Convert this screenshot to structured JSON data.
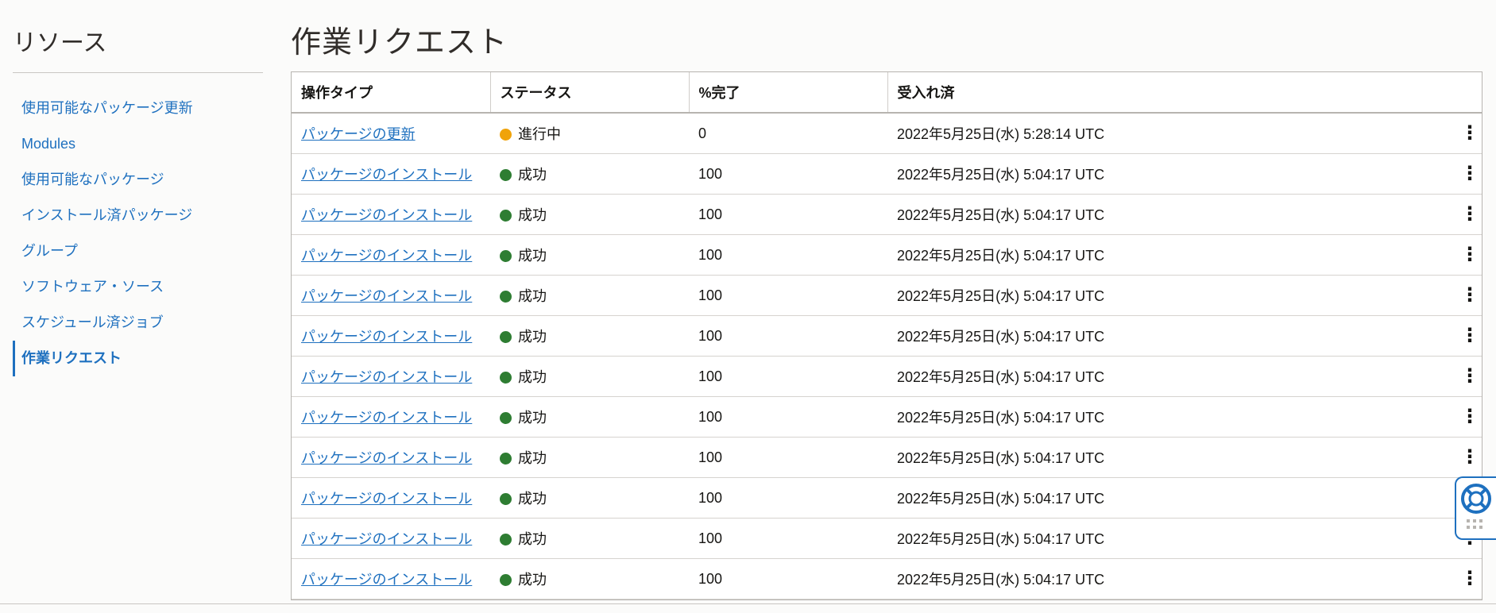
{
  "sidebar": {
    "title": "リソース",
    "items": [
      {
        "label": "使用可能なパッケージ更新"
      },
      {
        "label": "Modules"
      },
      {
        "label": "使用可能なパッケージ"
      },
      {
        "label": "インストール済パッケージ"
      },
      {
        "label": "グループ"
      },
      {
        "label": "ソフトウェア・ソース"
      },
      {
        "label": "スケジュール済ジョブ"
      },
      {
        "label": "作業リクエスト"
      }
    ],
    "active_index": 7
  },
  "page": {
    "title": "作業リクエスト"
  },
  "table": {
    "headers": [
      "操作タイプ",
      "ステータス",
      "%完了",
      "受入れ済"
    ],
    "rows": [
      {
        "type": "パッケージの更新",
        "status": "進行中",
        "percent": "0",
        "accepted": "2022年5月25日(水) 5:28:14 UTC"
      },
      {
        "type": "パッケージのインストール",
        "status": "成功",
        "percent": "100",
        "accepted": "2022年5月25日(水) 5:04:17 UTC"
      },
      {
        "type": "パッケージのインストール",
        "status": "成功",
        "percent": "100",
        "accepted": "2022年5月25日(水) 5:04:17 UTC"
      },
      {
        "type": "パッケージのインストール",
        "status": "成功",
        "percent": "100",
        "accepted": "2022年5月25日(水) 5:04:17 UTC"
      },
      {
        "type": "パッケージのインストール",
        "status": "成功",
        "percent": "100",
        "accepted": "2022年5月25日(水) 5:04:17 UTC"
      },
      {
        "type": "パッケージのインストール",
        "status": "成功",
        "percent": "100",
        "accepted": "2022年5月25日(水) 5:04:17 UTC"
      },
      {
        "type": "パッケージのインストール",
        "status": "成功",
        "percent": "100",
        "accepted": "2022年5月25日(水) 5:04:17 UTC"
      },
      {
        "type": "パッケージのインストール",
        "status": "成功",
        "percent": "100",
        "accepted": "2022年5月25日(水) 5:04:17 UTC"
      },
      {
        "type": "パッケージのインストール",
        "status": "成功",
        "percent": "100",
        "accepted": "2022年5月25日(水) 5:04:17 UTC"
      },
      {
        "type": "パッケージのインストール",
        "status": "成功",
        "percent": "100",
        "accepted": "2022年5月25日(水) 5:04:17 UTC"
      },
      {
        "type": "パッケージのインストール",
        "status": "成功",
        "percent": "100",
        "accepted": "2022年5月25日(水) 5:04:17 UTC"
      },
      {
        "type": "パッケージのインストール",
        "status": "成功",
        "percent": "100",
        "accepted": "2022年5月25日(水) 5:04:17 UTC"
      }
    ]
  },
  "colors": {
    "link": "#1e70bf",
    "in_progress": "#f0a30a",
    "success": "#2e7d32"
  },
  "icons": {
    "row_actions": "kebab-menu-icon",
    "help": "lifebuoy-icon",
    "drag": "drag-handle-icon"
  }
}
